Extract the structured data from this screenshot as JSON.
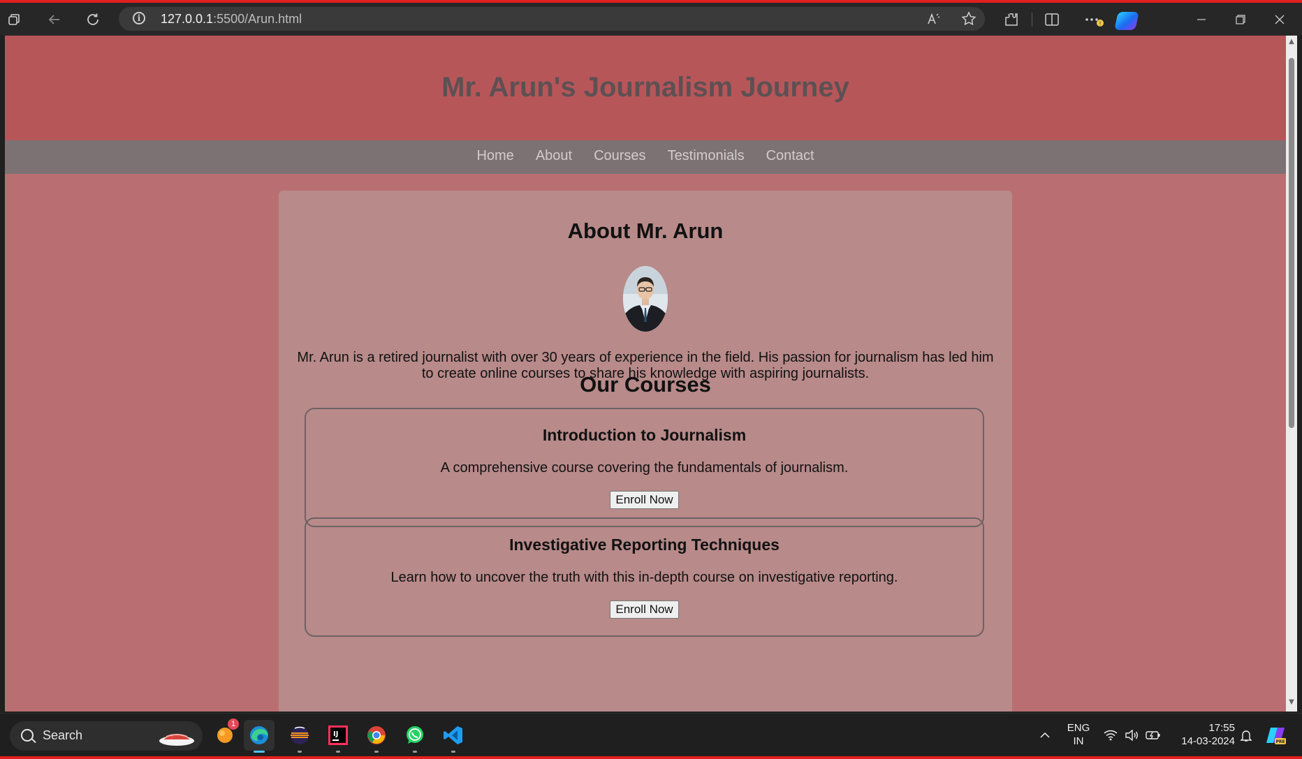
{
  "browser": {
    "url_host": "127.0.0.1",
    "url_rest": ":5500/Arun.html"
  },
  "site": {
    "title": "Mr. Arun's Journalism Journey",
    "nav": [
      "Home",
      "About",
      "Courses",
      "Testimonials",
      "Contact"
    ],
    "about_heading": "About Mr. Arun",
    "about_text": "Mr. Arun is a retired journalist with over 30 years of experience in the field. His passion for journalism has led him to create online courses to share his knowledge with aspiring journalists.",
    "courses_heading": "Our Courses",
    "courses": [
      {
        "title": "Introduction to Journalism",
        "description": "A comprehensive course covering the fundamentals of journalism.",
        "button": "Enroll Now"
      },
      {
        "title": "Investigative Reporting Techniques",
        "description": "Learn how to uncover the truth with this in-depth course on investigative reporting.",
        "button": "Enroll Now"
      }
    ]
  },
  "taskbar": {
    "search_label": "Search",
    "notification_count": "1",
    "language": "ENG",
    "region": "IN",
    "time": "17:55",
    "date": "14-03-2024"
  },
  "colors": {
    "header_bg": "#b75659",
    "nav_bg": "#7c7173",
    "page_bg": "#b96f71",
    "card_bg": "#b88a8a",
    "title_text": "#5d5053"
  }
}
